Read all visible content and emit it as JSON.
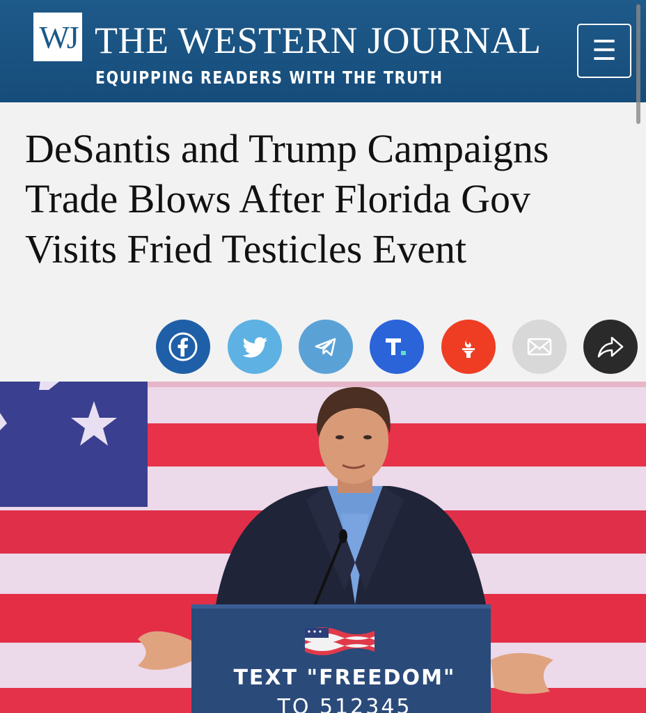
{
  "header": {
    "logo_text": "WJ",
    "site_name": "THE WESTERN JOURNAL",
    "tagline": "EQUIPPING READERS WITH THE TRUTH",
    "menu_icon": "hamburger-menu-icon",
    "background_color": "#1b5585"
  },
  "article": {
    "headline": "DeSantis and Trump Campaigns Trade Blows After Florida Gov Visits Fried Testicles Event"
  },
  "share": [
    {
      "name": "facebook",
      "icon": "facebook-icon",
      "color": "#1f5fa8"
    },
    {
      "name": "twitter",
      "icon": "twitter-icon",
      "color": "#5eb1e3"
    },
    {
      "name": "telegram",
      "icon": "telegram-icon",
      "color": "#5aa2d6"
    },
    {
      "name": "truth-social",
      "icon": "truth-social-icon",
      "color": "#2b63d9"
    },
    {
      "name": "gab",
      "icon": "gab-icon",
      "color": "#ef3d24"
    },
    {
      "name": "email",
      "icon": "email-icon",
      "color": "#d8d8d8"
    },
    {
      "name": "share",
      "icon": "share-arrow-icon",
      "color": "#2a2a2a"
    }
  ],
  "hero_image": {
    "podium_text_line1": "TEXT \"FREEDOM\"",
    "podium_text_line2": "TO 512345"
  }
}
